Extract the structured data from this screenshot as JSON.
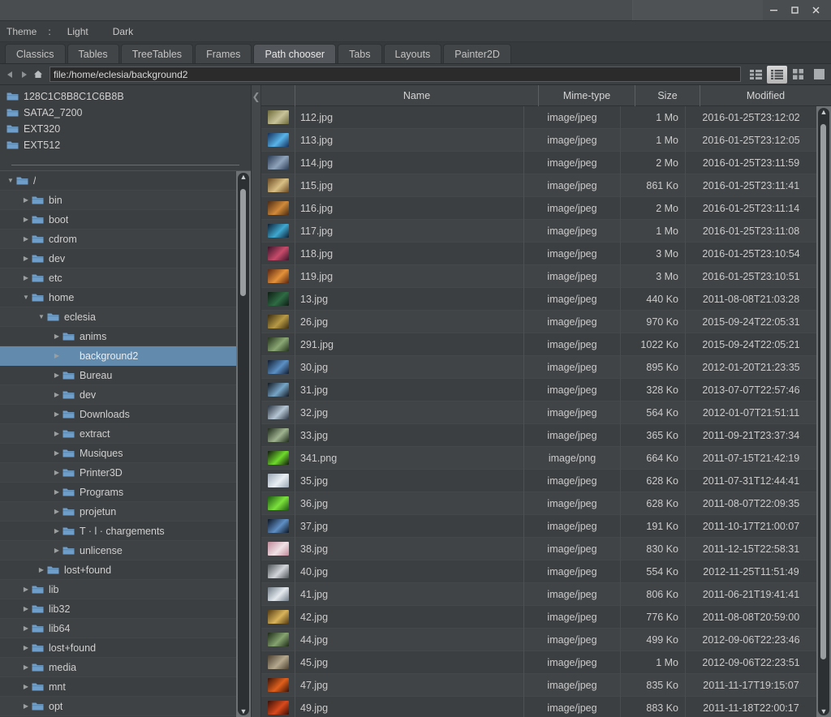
{
  "window": {
    "title": "",
    "controls": {
      "minimize": "minimize-icon",
      "maximize": "maximize-icon",
      "close": "close-icon"
    }
  },
  "theme_bar": {
    "label": "Theme",
    "separator": ":",
    "options": [
      "Light",
      "Dark"
    ]
  },
  "tabs": {
    "items": [
      {
        "label": "Classics",
        "active": false
      },
      {
        "label": "Tables",
        "active": false
      },
      {
        "label": "TreeTables",
        "active": false
      },
      {
        "label": "Frames",
        "active": false
      },
      {
        "label": "Path chooser",
        "active": true
      },
      {
        "label": "Tabs",
        "active": false
      },
      {
        "label": "Layouts",
        "active": false
      },
      {
        "label": "Painter2D",
        "active": false
      }
    ]
  },
  "pathbar": {
    "back": "back-arrow-icon",
    "forward": "forward-arrow-icon",
    "home": "home-icon",
    "value": "file:/home/eclesia/background2",
    "placeholder": "file:/",
    "view_modes": [
      {
        "name": "detail-columns-view",
        "active": false
      },
      {
        "name": "list-view",
        "active": true
      },
      {
        "name": "grid-view",
        "active": false
      },
      {
        "name": "large-icon-view",
        "active": false
      }
    ]
  },
  "sidebar": {
    "shortcuts": [
      {
        "label": "128C1C8B8C1C6B8B"
      },
      {
        "label": "SATA2_7200"
      },
      {
        "label": "EXT320"
      },
      {
        "label": "EXT512"
      }
    ],
    "tree": [
      {
        "label": "/",
        "depth": 0,
        "expanded": true,
        "has_children": true,
        "selected": false,
        "folder": true
      },
      {
        "label": "bin",
        "depth": 1,
        "expanded": false,
        "has_children": true,
        "selected": false,
        "folder": true
      },
      {
        "label": "boot",
        "depth": 1,
        "expanded": false,
        "has_children": true,
        "selected": false,
        "folder": true
      },
      {
        "label": "cdrom",
        "depth": 1,
        "expanded": false,
        "has_children": true,
        "selected": false,
        "folder": true
      },
      {
        "label": "dev",
        "depth": 1,
        "expanded": false,
        "has_children": true,
        "selected": false,
        "folder": true
      },
      {
        "label": "etc",
        "depth": 1,
        "expanded": false,
        "has_children": true,
        "selected": false,
        "folder": true
      },
      {
        "label": "home",
        "depth": 1,
        "expanded": true,
        "has_children": true,
        "selected": false,
        "folder": true
      },
      {
        "label": "eclesia",
        "depth": 2,
        "expanded": true,
        "has_children": true,
        "selected": false,
        "folder": true
      },
      {
        "label": "anims",
        "depth": 3,
        "expanded": false,
        "has_children": true,
        "selected": false,
        "folder": true
      },
      {
        "label": "background2",
        "depth": 3,
        "expanded": false,
        "has_children": true,
        "selected": true,
        "folder": false
      },
      {
        "label": "Bureau",
        "depth": 3,
        "expanded": false,
        "has_children": true,
        "selected": false,
        "folder": true
      },
      {
        "label": "dev",
        "depth": 3,
        "expanded": false,
        "has_children": true,
        "selected": false,
        "folder": true
      },
      {
        "label": "Downloads",
        "depth": 3,
        "expanded": false,
        "has_children": true,
        "selected": false,
        "folder": true
      },
      {
        "label": "extract",
        "depth": 3,
        "expanded": false,
        "has_children": true,
        "selected": false,
        "folder": true
      },
      {
        "label": "Musiques",
        "depth": 3,
        "expanded": false,
        "has_children": true,
        "selected": false,
        "folder": true
      },
      {
        "label": "Printer3D",
        "depth": 3,
        "expanded": false,
        "has_children": true,
        "selected": false,
        "folder": true
      },
      {
        "label": "Programs",
        "depth": 3,
        "expanded": false,
        "has_children": true,
        "selected": false,
        "folder": true
      },
      {
        "label": "projetun",
        "depth": 3,
        "expanded": false,
        "has_children": true,
        "selected": false,
        "folder": true
      },
      {
        "label": "T · l · chargements",
        "depth": 3,
        "expanded": false,
        "has_children": true,
        "selected": false,
        "folder": true
      },
      {
        "label": "unlicense",
        "depth": 3,
        "expanded": false,
        "has_children": true,
        "selected": false,
        "folder": true
      },
      {
        "label": "lost+found",
        "depth": 2,
        "expanded": false,
        "has_children": true,
        "selected": false,
        "folder": true
      },
      {
        "label": "lib",
        "depth": 1,
        "expanded": false,
        "has_children": true,
        "selected": false,
        "folder": true
      },
      {
        "label": "lib32",
        "depth": 1,
        "expanded": false,
        "has_children": true,
        "selected": false,
        "folder": true
      },
      {
        "label": "lib64",
        "depth": 1,
        "expanded": false,
        "has_children": true,
        "selected": false,
        "folder": true
      },
      {
        "label": "lost+found",
        "depth": 1,
        "expanded": false,
        "has_children": true,
        "selected": false,
        "folder": true
      },
      {
        "label": "media",
        "depth": 1,
        "expanded": false,
        "has_children": true,
        "selected": false,
        "folder": true
      },
      {
        "label": "mnt",
        "depth": 1,
        "expanded": false,
        "has_children": true,
        "selected": false,
        "folder": true
      },
      {
        "label": "opt",
        "depth": 1,
        "expanded": false,
        "has_children": true,
        "selected": false,
        "folder": true
      }
    ]
  },
  "file_table": {
    "collapse_handle": "chevron-left-icon",
    "columns": [
      "",
      "Name",
      "Mime-type",
      "Size",
      "Modified"
    ],
    "rows": [
      {
        "name": "112.jpg",
        "mime": "image/jpeg",
        "size": "1 Mo",
        "modified": "2016-01-25T23:12:02",
        "c1": "#6d6a3a",
        "c2": "#c9c39a"
      },
      {
        "name": "113.jpg",
        "mime": "image/jpeg",
        "size": "1 Mo",
        "modified": "2016-01-25T23:12:05",
        "c1": "#13305c",
        "c2": "#59b4e8"
      },
      {
        "name": "114.jpg",
        "mime": "image/jpeg",
        "size": "2 Mo",
        "modified": "2016-01-25T23:11:59",
        "c1": "#2b3c55",
        "c2": "#8fa3bb"
      },
      {
        "name": "115.jpg",
        "mime": "image/jpeg",
        "size": "861 Ko",
        "modified": "2016-01-25T23:11:41",
        "c1": "#6b4a22",
        "c2": "#d8bf85"
      },
      {
        "name": "116.jpg",
        "mime": "image/jpeg",
        "size": "2 Mo",
        "modified": "2016-01-25T23:11:14",
        "c1": "#4a2a12",
        "c2": "#d08a3a"
      },
      {
        "name": "117.jpg",
        "mime": "image/jpeg",
        "size": "1 Mo",
        "modified": "2016-01-25T23:11:08",
        "c1": "#0d2033",
        "c2": "#3fa8cf"
      },
      {
        "name": "118.jpg",
        "mime": "image/jpeg",
        "size": "3 Mo",
        "modified": "2016-01-25T23:10:54",
        "c1": "#3a1429",
        "c2": "#c84b6b"
      },
      {
        "name": "119.jpg",
        "mime": "image/jpeg",
        "size": "3 Mo",
        "modified": "2016-01-25T23:10:51",
        "c1": "#5a2510",
        "c2": "#e3923a"
      },
      {
        "name": "13.jpg",
        "mime": "image/jpeg",
        "size": "440 Ko",
        "modified": "2011-08-08T21:03:28",
        "c1": "#0d1d14",
        "c2": "#2e6b44"
      },
      {
        "name": "26.jpg",
        "mime": "image/jpeg",
        "size": "970 Ko",
        "modified": "2015-09-24T22:05:31",
        "c1": "#3a2c10",
        "c2": "#b79a45"
      },
      {
        "name": "291.jpg",
        "mime": "image/jpeg",
        "size": "1022 Ko",
        "modified": "2015-09-24T22:05:21",
        "c1": "#23331c",
        "c2": "#8ba774"
      },
      {
        "name": "30.jpg",
        "mime": "image/jpeg",
        "size": "895 Ko",
        "modified": "2012-01-20T21:23:35",
        "c1": "#101c2e",
        "c2": "#5b90c4"
      },
      {
        "name": "31.jpg",
        "mime": "image/jpeg",
        "size": "328 Ko",
        "modified": "2013-07-07T22:57:46",
        "c1": "#101820",
        "c2": "#77a6c7"
      },
      {
        "name": "32.jpg",
        "mime": "image/jpeg",
        "size": "564 Ko",
        "modified": "2012-01-07T21:51:11",
        "c1": "#2a3442",
        "c2": "#b7c6d4"
      },
      {
        "name": "33.jpg",
        "mime": "image/jpeg",
        "size": "365 Ko",
        "modified": "2011-09-21T23:37:34",
        "c1": "#1e2a1a",
        "c2": "#9fb390"
      },
      {
        "name": "341.png",
        "mime": "image/png",
        "size": "664 Ko",
        "modified": "2011-07-15T21:42:19",
        "c1": "#101a0c",
        "c2": "#6ed92c"
      },
      {
        "name": "35.jpg",
        "mime": "image/jpeg",
        "size": "628 Ko",
        "modified": "2011-07-31T12:44:41",
        "c1": "#9aa6b4",
        "c2": "#e9eef3"
      },
      {
        "name": "36.jpg",
        "mime": "image/jpeg",
        "size": "628 Ko",
        "modified": "2011-08-07T22:09:35",
        "c1": "#1c5a12",
        "c2": "#7ce23c"
      },
      {
        "name": "37.jpg",
        "mime": "image/jpeg",
        "size": "191 Ko",
        "modified": "2011-10-17T21:00:07",
        "c1": "#0b1422",
        "c2": "#5e8fc4"
      },
      {
        "name": "38.jpg",
        "mime": "image/jpeg",
        "size": "830 Ko",
        "modified": "2011-12-15T22:58:31",
        "c1": "#c08a9a",
        "c2": "#f0e2e6"
      },
      {
        "name": "40.jpg",
        "mime": "image/jpeg",
        "size": "554 Ko",
        "modified": "2012-11-25T11:51:49",
        "c1": "#4e5358",
        "c2": "#d2d6da"
      },
      {
        "name": "41.jpg",
        "mime": "image/jpeg",
        "size": "806 Ko",
        "modified": "2011-06-21T19:41:41",
        "c1": "#6f7a86",
        "c2": "#e4e9ee"
      },
      {
        "name": "42.jpg",
        "mime": "image/jpeg",
        "size": "776 Ko",
        "modified": "2011-08-08T20:59:00",
        "c1": "#533a12",
        "c2": "#d8b45a"
      },
      {
        "name": "44.jpg",
        "mime": "image/jpeg",
        "size": "499 Ko",
        "modified": "2012-09-06T22:23:46",
        "c1": "#1c2a16",
        "c2": "#86a370"
      },
      {
        "name": "45.jpg",
        "mime": "image/jpeg",
        "size": "1 Mo",
        "modified": "2012-09-06T22:23:51",
        "c1": "#4c4030",
        "c2": "#b5a88e"
      },
      {
        "name": "47.jpg",
        "mime": "image/jpeg",
        "size": "835 Ko",
        "modified": "2011-11-17T19:15:07",
        "c1": "#3a1206",
        "c2": "#e0601c"
      },
      {
        "name": "49.jpg",
        "mime": "image/jpeg",
        "size": "883 Ko",
        "modified": "2011-11-18T22:00:17",
        "c1": "#3a0e06",
        "c2": "#d94a1c"
      }
    ]
  },
  "colors": {
    "background": "#3c3f41",
    "selection": "#628aad",
    "folder_icon": "#6e9ec9",
    "text": "#cbcbcb",
    "scrollbar_track": "#2d3032",
    "scrollbar_thumb": "#9a9d9f"
  }
}
